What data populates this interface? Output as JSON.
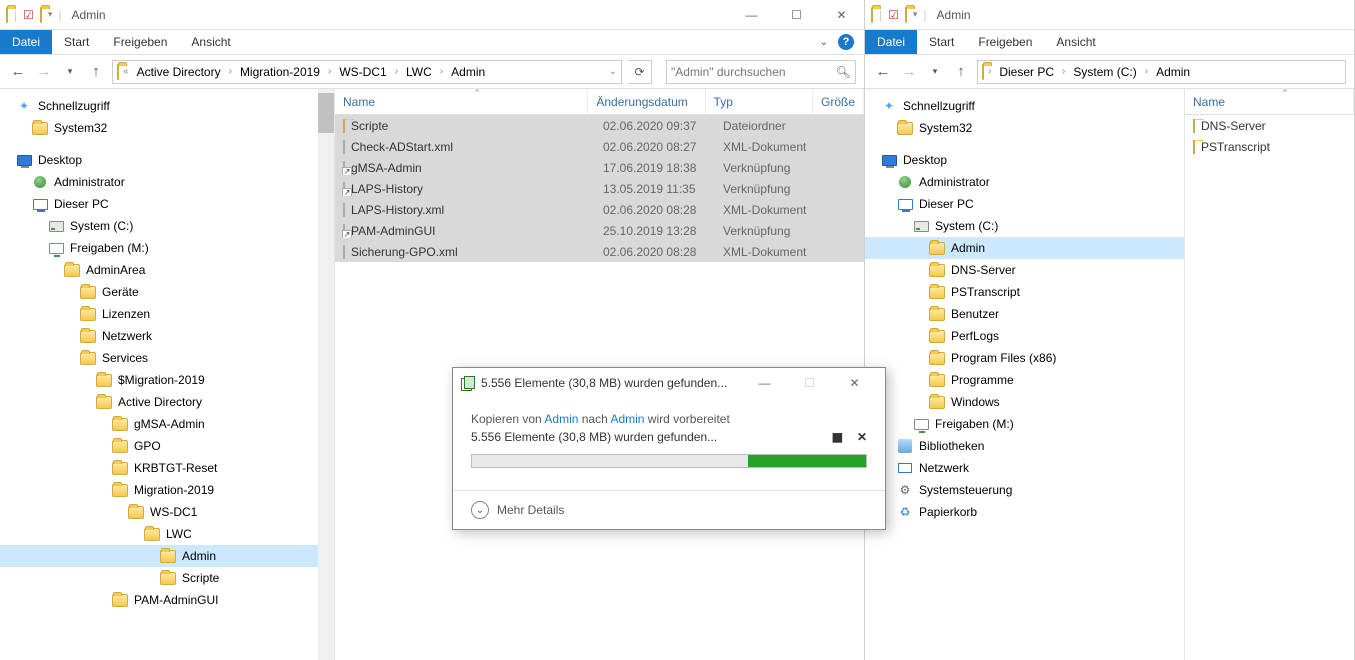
{
  "left": {
    "title": "Admin",
    "tabs": {
      "file": "Datei",
      "start": "Start",
      "share": "Freigeben",
      "view": "Ansicht"
    },
    "breadcrumb": [
      "Active Directory",
      "Migration-2019",
      "WS-DC1",
      "LWC",
      "Admin"
    ],
    "search_placeholder": "\"Admin\" durchsuchen",
    "columns": {
      "name": "Name",
      "date": "Änderungsdatum",
      "type": "Typ",
      "size": "Größe"
    },
    "rows": [
      {
        "icon": "folder",
        "name": "Scripte",
        "date": "02.06.2020 09:37",
        "type": "Dateiordner",
        "sel": true
      },
      {
        "icon": "file",
        "name": "Check-ADStart.xml",
        "date": "02.06.2020 08:27",
        "type": "XML-Dokument",
        "sel": true
      },
      {
        "icon": "link",
        "name": "gMSA-Admin",
        "date": "17.06.2019 18:38",
        "type": "Verknüpfung",
        "sel": true
      },
      {
        "icon": "link",
        "name": "LAPS-History",
        "date": "13.05.2019 11:35",
        "type": "Verknüpfung",
        "sel": true
      },
      {
        "icon": "file",
        "name": "LAPS-History.xml",
        "date": "02.06.2020 08:28",
        "type": "XML-Dokument",
        "sel": true
      },
      {
        "icon": "link",
        "name": "PAM-AdminGUI",
        "date": "25.10.2019 13:28",
        "type": "Verknüpfung",
        "sel": true
      },
      {
        "icon": "file",
        "name": "Sicherung-GPO.xml",
        "date": "02.06.2020 08:28",
        "type": "XML-Dokument",
        "sel": true
      }
    ],
    "tree": [
      {
        "d": 0,
        "icon": "pin",
        "label": "Schnellzugriff"
      },
      {
        "d": 1,
        "icon": "folder",
        "label": "System32"
      },
      {
        "d": 0,
        "spacer": true
      },
      {
        "d": 0,
        "icon": "desktop",
        "label": "Desktop"
      },
      {
        "d": 1,
        "icon": "user",
        "label": "Administrator"
      },
      {
        "d": 1,
        "icon": "pc",
        "label": "Dieser PC"
      },
      {
        "d": 2,
        "icon": "disk",
        "label": "System (C:)"
      },
      {
        "d": 2,
        "icon": "share",
        "label": "Freigaben (M:)"
      },
      {
        "d": 3,
        "icon": "folder",
        "label": "AdminArea"
      },
      {
        "d": 4,
        "icon": "folder",
        "label": "Geräte"
      },
      {
        "d": 4,
        "icon": "folder",
        "label": "Lizenzen"
      },
      {
        "d": 4,
        "icon": "folder",
        "label": "Netzwerk"
      },
      {
        "d": 4,
        "icon": "folder",
        "label": "Services"
      },
      {
        "d": 5,
        "icon": "folder",
        "label": "$Migration-2019"
      },
      {
        "d": 5,
        "icon": "folder",
        "label": "Active Directory"
      },
      {
        "d": 6,
        "icon": "folder",
        "label": "gMSA-Admin"
      },
      {
        "d": 6,
        "icon": "folder",
        "label": "GPO"
      },
      {
        "d": 6,
        "icon": "folder",
        "label": "KRBTGT-Reset"
      },
      {
        "d": 6,
        "icon": "folder",
        "label": "Migration-2019"
      },
      {
        "d": 7,
        "icon": "folder",
        "label": "WS-DC1"
      },
      {
        "d": 8,
        "icon": "folder",
        "label": "LWC"
      },
      {
        "d": 9,
        "icon": "folder",
        "label": "Admin",
        "sel": true
      },
      {
        "d": 9,
        "icon": "folder",
        "label": "Scripte"
      },
      {
        "d": 6,
        "icon": "folder",
        "label": "PAM-AdminGUI"
      }
    ]
  },
  "right": {
    "title": "Admin",
    "tabs": {
      "file": "Datei",
      "start": "Start",
      "share": "Freigeben",
      "view": "Ansicht"
    },
    "breadcrumb": [
      "Dieser PC",
      "System (C:)",
      "Admin"
    ],
    "columns": {
      "name": "Name"
    },
    "rows": [
      {
        "icon": "folder",
        "name": "DNS-Server"
      },
      {
        "icon": "folder",
        "name": "PSTranscript"
      }
    ],
    "tree": [
      {
        "d": 0,
        "icon": "pin",
        "label": "Schnellzugriff"
      },
      {
        "d": 1,
        "icon": "folder",
        "label": "System32"
      },
      {
        "d": 0,
        "spacer": true
      },
      {
        "d": 0,
        "icon": "desktop",
        "label": "Desktop"
      },
      {
        "d": 1,
        "icon": "user",
        "label": "Administrator"
      },
      {
        "d": 1,
        "icon": "pc",
        "label": "Dieser PC"
      },
      {
        "d": 2,
        "icon": "disk",
        "label": "System (C:)"
      },
      {
        "d": 3,
        "icon": "folder",
        "label": "Admin",
        "sel": true
      },
      {
        "d": 3,
        "icon": "folder",
        "label": "DNS-Server"
      },
      {
        "d": 3,
        "icon": "folder",
        "label": "PSTranscript"
      },
      {
        "d": 3,
        "icon": "folder",
        "label": "Benutzer"
      },
      {
        "d": 3,
        "icon": "folder",
        "label": "PerfLogs"
      },
      {
        "d": 3,
        "icon": "folder",
        "label": "Program Files (x86)"
      },
      {
        "d": 3,
        "icon": "folder",
        "label": "Programme"
      },
      {
        "d": 3,
        "icon": "folder",
        "label": "Windows"
      },
      {
        "d": 2,
        "icon": "share",
        "label": "Freigaben (M:)"
      },
      {
        "d": 1,
        "icon": "lib",
        "label": "Bibliotheken"
      },
      {
        "d": 1,
        "icon": "net",
        "label": "Netzwerk"
      },
      {
        "d": 1,
        "icon": "gear",
        "label": "Systemsteuerung"
      },
      {
        "d": 1,
        "icon": "recyc",
        "label": "Papierkorb"
      }
    ]
  },
  "dialog": {
    "title": "5.556 Elemente (30,8 MB) wurden gefunden...",
    "line1_pre": "Kopieren von ",
    "line1_src": "Admin",
    "line1_mid": " nach ",
    "line1_dst": "Admin",
    "line1_post": " wird vorbereitet",
    "line2": "5.556 Elemente (30,8 MB) wurden gefunden...",
    "more": "Mehr Details",
    "progress_pct": 30
  }
}
